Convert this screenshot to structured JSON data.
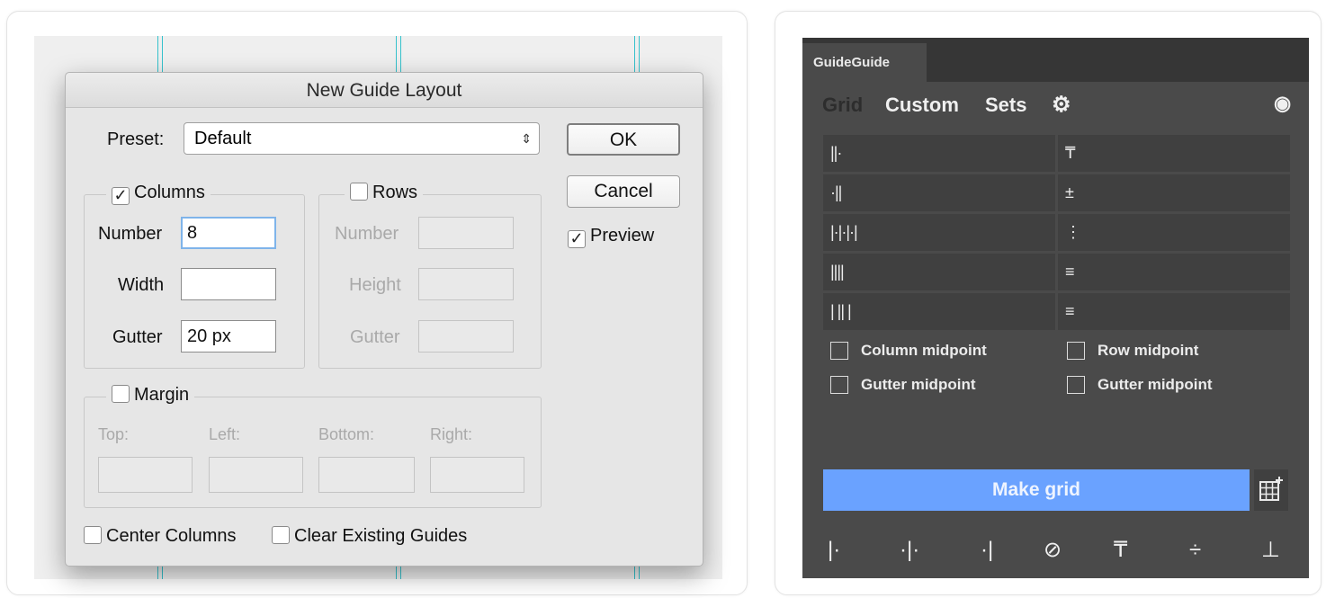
{
  "dialog": {
    "title": "New Guide Layout",
    "preset_label": "Preset:",
    "preset_value": "Default",
    "ok_label": "OK",
    "cancel_label": "Cancel",
    "preview_label": "Preview",
    "preview_checked": true,
    "columns": {
      "legend": "Columns",
      "checked": true,
      "number_label": "Number",
      "number_value": "8",
      "width_label": "Width",
      "width_value": "",
      "gutter_label": "Gutter",
      "gutter_value": "20 px"
    },
    "rows": {
      "legend": "Rows",
      "checked": false,
      "number_label": "Number",
      "height_label": "Height",
      "gutter_label": "Gutter"
    },
    "margin": {
      "legend": "Margin",
      "checked": false,
      "top_label": "Top:",
      "left_label": "Left:",
      "bottom_label": "Bottom:",
      "right_label": "Right:"
    },
    "center_columns_label": "Center Columns",
    "clear_guides_label": "Clear Existing Guides"
  },
  "guideguide": {
    "tab_label": "GuideGuide",
    "nav": {
      "grid": "Grid",
      "custom": "Custom",
      "sets": "Sets"
    },
    "left_cells": [
      "||·",
      "·||",
      "|·|·|·|",
      "||||",
      "| || |"
    ],
    "right_cells": [
      "₸",
      "±",
      "⋮",
      "≡",
      "≡"
    ],
    "column_midpoint_label": "Column midpoint",
    "row_midpoint_label": "Row midpoint",
    "gutter_midpoint_col_label": "Gutter midpoint",
    "gutter_midpoint_row_label": "Gutter midpoint",
    "make_grid_label": "Make grid",
    "accent_color": "#6aa2ff",
    "panel_bg_color": "#4a4a4a"
  }
}
